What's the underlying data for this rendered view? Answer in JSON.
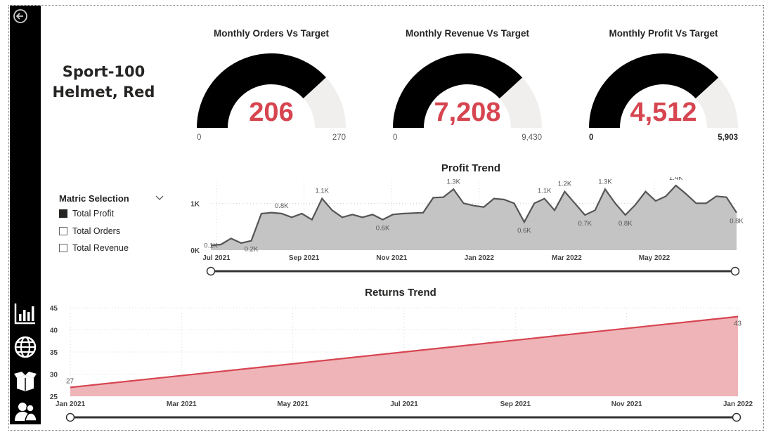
{
  "product_title_line1": "Sport-100",
  "product_title_line2": "Helmet, Red",
  "gauges": [
    {
      "title": "Monthly Orders Vs Target",
      "value": "206",
      "min": "0",
      "max": "270",
      "fraction": 0.763
    },
    {
      "title": "Monthly Revenue Vs Target",
      "value": "7,208",
      "min": "0",
      "max": "9,430",
      "fraction": 0.764
    },
    {
      "title": "Monthly Profit Vs Target",
      "value": "4,512",
      "min": "0",
      "max": "5,903",
      "fraction": 0.764
    }
  ],
  "slicer": {
    "title": "Matric Selection",
    "items": [
      {
        "label": "Total Profit",
        "checked": true
      },
      {
        "label": "Total Orders",
        "checked": false
      },
      {
        "label": "Total Revenue",
        "checked": false
      }
    ]
  },
  "sidebar_icons": [
    "back-arrow-icon",
    "bar-chart-icon",
    "globe-icon",
    "box-icon",
    "users-icon"
  ],
  "colors": {
    "accent_red": "#d64550",
    "gauge_fill": "#000000",
    "gauge_track": "#f0efee",
    "profit_area": "#c4c4c4",
    "profit_line": "#555555",
    "returns_area": "#efb4b8",
    "returns_line": "#d64550"
  },
  "chart_data": [
    {
      "type": "area",
      "title": "Profit Trend",
      "x_ticks": [
        "Jul 2021",
        "Sep 2021",
        "Nov 2021",
        "Jan 2022",
        "Mar 2022",
        "May 2022"
      ],
      "y_ticks": [
        "0K",
        "1K"
      ],
      "ylim": [
        0,
        1.5
      ],
      "values": [
        0.1,
        0.12,
        0.25,
        0.15,
        0.2,
        0.78,
        0.8,
        0.78,
        0.7,
        0.78,
        0.65,
        1.1,
        0.85,
        0.7,
        0.76,
        0.7,
        0.76,
        0.65,
        0.76,
        0.78,
        0.79,
        0.8,
        1.12,
        1.13,
        1.3,
        1.0,
        0.95,
        0.92,
        1.1,
        1.08,
        1.0,
        0.6,
        1.0,
        1.1,
        0.85,
        1.25,
        1.0,
        0.75,
        0.85,
        1.3,
        1.0,
        0.75,
        0.97,
        1.25,
        1.05,
        1.15,
        1.38,
        1.2,
        1.0,
        1.0,
        1.15,
        1.13,
        0.8
      ],
      "data_labels": [
        {
          "i": 0,
          "text": "0.1K"
        },
        {
          "i": 4,
          "text": "0.2K"
        },
        {
          "i": 7,
          "text": "0.8K"
        },
        {
          "i": 11,
          "text": "1.1K"
        },
        {
          "i": 17,
          "text": "0.6K"
        },
        {
          "i": 24,
          "text": "1.3K"
        },
        {
          "i": 31,
          "text": "0.6K"
        },
        {
          "i": 33,
          "text": "1.1K"
        },
        {
          "i": 35,
          "text": "1.2K"
        },
        {
          "i": 37,
          "text": "0.7K"
        },
        {
          "i": 39,
          "text": "1.3K"
        },
        {
          "i": 41,
          "text": "0.8K"
        },
        {
          "i": 46,
          "text": "1.4K"
        },
        {
          "i": 52,
          "text": "0.8K"
        }
      ]
    },
    {
      "type": "area",
      "title": "Returns Trend",
      "x_ticks": [
        "Jan 2021",
        "Mar 2021",
        "May 2021",
        "Jul 2021",
        "Sep 2021",
        "Nov 2021",
        "Jan 2022"
      ],
      "y_ticks": [
        "25",
        "30",
        "35",
        "40",
        "45"
      ],
      "ylim": [
        25,
        45
      ],
      "x": [
        "Jan 2021",
        "Jan 2022"
      ],
      "values": [
        27,
        43
      ],
      "data_labels": [
        {
          "i": 0,
          "text": "27"
        },
        {
          "i": 1,
          "text": "43"
        }
      ]
    }
  ]
}
